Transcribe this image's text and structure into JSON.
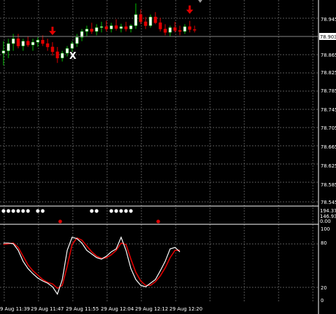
{
  "theme": {
    "background": "#000000",
    "grid": "#5a5a5a",
    "bull": "#00c000",
    "bear": "#e00000",
    "text": "#ffffff",
    "current_price_bg": "#ffffff"
  },
  "main_panel": {
    "price_scale": [
      "78.945",
      "78.903",
      "78.865",
      "78.825",
      "78.785",
      "78.745",
      "78.705",
      "78.665",
      "78.625",
      "78.585",
      "78.545"
    ],
    "current_price": "78.903",
    "signal_arrows": [
      {
        "direction": "down",
        "color": "#e00000",
        "candle": 10
      },
      {
        "direction": "down",
        "color": "#e00000",
        "candle": 38
      }
    ],
    "cursor_mark": {
      "symbol": "X",
      "candle": 14
    }
  },
  "middle_panel": {
    "scale_labels": [
      "194.37",
      "146.93",
      "0.00"
    ],
    "white_dots_groups": [
      [
        0,
        1,
        2,
        3,
        4,
        5
      ],
      [
        7,
        8
      ],
      [
        18,
        19
      ],
      [
        22,
        23,
        24,
        25,
        26
      ]
    ],
    "red_dots": [
      11,
      31
    ]
  },
  "stoch_panel": {
    "scale_labels": [
      "100",
      "80",
      "20",
      "0"
    ]
  },
  "time_axis": [
    "9 Aug 11:39",
    "29 Aug 11:47",
    "29 Aug 11:55",
    "29 Aug 12:04",
    "29 Aug 12:12",
    "29 Aug 12:20"
  ],
  "chart_data": {
    "type": "candlestick",
    "y_range": [
      78.545,
      78.965
    ],
    "candles": [
      [
        78.855,
        78.88,
        78.83,
        78.86
      ],
      [
        78.86,
        78.885,
        78.845,
        78.875
      ],
      [
        78.875,
        78.895,
        78.86,
        78.885
      ],
      [
        78.885,
        78.895,
        78.865,
        78.87
      ],
      [
        78.87,
        78.885,
        78.86,
        78.88
      ],
      [
        78.88,
        78.89,
        78.868,
        78.872
      ],
      [
        78.872,
        78.885,
        78.86,
        78.878
      ],
      [
        78.878,
        78.888,
        78.868,
        78.882
      ],
      [
        78.882,
        78.892,
        78.87,
        78.875
      ],
      [
        78.875,
        78.885,
        78.86,
        78.868
      ],
      [
        78.868,
        78.878,
        78.85,
        78.858
      ],
      [
        78.858,
        78.868,
        78.835,
        78.845
      ],
      [
        78.845,
        78.86,
        78.838,
        78.855
      ],
      [
        78.855,
        78.87,
        78.848,
        78.865
      ],
      [
        78.865,
        78.88,
        78.858,
        78.875
      ],
      [
        78.875,
        78.895,
        78.868,
        78.888
      ],
      [
        78.888,
        78.905,
        78.88,
        78.9
      ],
      [
        78.9,
        78.912,
        78.89,
        78.905
      ],
      [
        78.905,
        78.918,
        78.895,
        78.9
      ],
      [
        78.9,
        78.915,
        78.892,
        78.908
      ],
      [
        78.908,
        78.92,
        78.898,
        78.91
      ],
      [
        78.91,
        78.922,
        78.9,
        78.905
      ],
      [
        78.905,
        78.918,
        78.898,
        78.912
      ],
      [
        78.912,
        78.925,
        78.902,
        78.906
      ],
      [
        78.906,
        78.916,
        78.898,
        78.91
      ],
      [
        78.91,
        78.92,
        78.9,
        78.905
      ],
      [
        78.905,
        78.915,
        78.898,
        78.912
      ],
      [
        78.912,
        78.958,
        78.905,
        78.935
      ],
      [
        78.935,
        78.945,
        78.915,
        78.92
      ],
      [
        78.92,
        78.93,
        78.905,
        78.912
      ],
      [
        78.912,
        78.935,
        78.908,
        78.93
      ],
      [
        78.93,
        78.94,
        78.915,
        78.918
      ],
      [
        78.918,
        78.928,
        78.9,
        78.905
      ],
      [
        78.905,
        78.915,
        78.892,
        78.898
      ],
      [
        78.898,
        78.912,
        78.89,
        78.908
      ],
      [
        78.908,
        78.92,
        78.898,
        78.902
      ],
      [
        78.902,
        78.912,
        78.892,
        78.9
      ],
      [
        78.9,
        78.915,
        78.895,
        78.91
      ],
      [
        78.91,
        78.922,
        78.898,
        78.904
      ],
      [
        78.904,
        78.912,
        78.898,
        78.903
      ]
    ],
    "stoch_main": [
      80,
      80,
      79,
      70,
      55,
      45,
      38,
      32,
      28,
      25,
      20,
      10,
      30,
      70,
      88,
      86,
      80,
      70,
      65,
      60,
      58,
      62,
      68,
      72,
      88,
      70,
      45,
      30,
      22,
      20,
      25,
      30,
      42,
      55,
      72,
      74,
      68
    ],
    "stoch_signal": [
      78,
      79,
      80,
      74,
      62,
      50,
      42,
      36,
      30,
      26,
      24,
      18,
      22,
      48,
      78,
      87,
      84,
      76,
      68,
      62,
      59,
      60,
      64,
      70,
      80,
      78,
      58,
      40,
      28,
      22,
      22,
      27,
      35,
      46,
      60,
      70,
      70
    ]
  }
}
